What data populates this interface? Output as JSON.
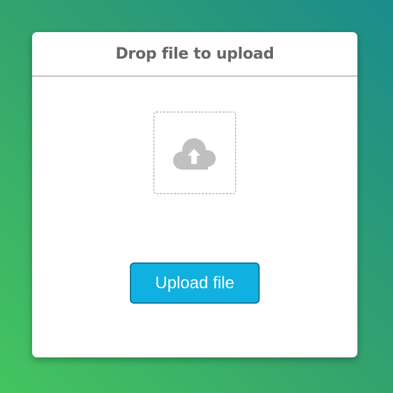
{
  "uploader": {
    "title": "Drop file to upload",
    "drop_zone_icon": "cloud-upload-icon",
    "button_label": "Upload file"
  },
  "colors": {
    "background_gradient": [
      "#44c460",
      "#1b8c8c"
    ],
    "card": "#ffffff",
    "title_text": "#666666",
    "divider": "#c4c4c4",
    "icon": "#c0c0c0",
    "button": "#10b1e0",
    "button_border": "#0d79a1",
    "button_text": "#ffffff"
  }
}
